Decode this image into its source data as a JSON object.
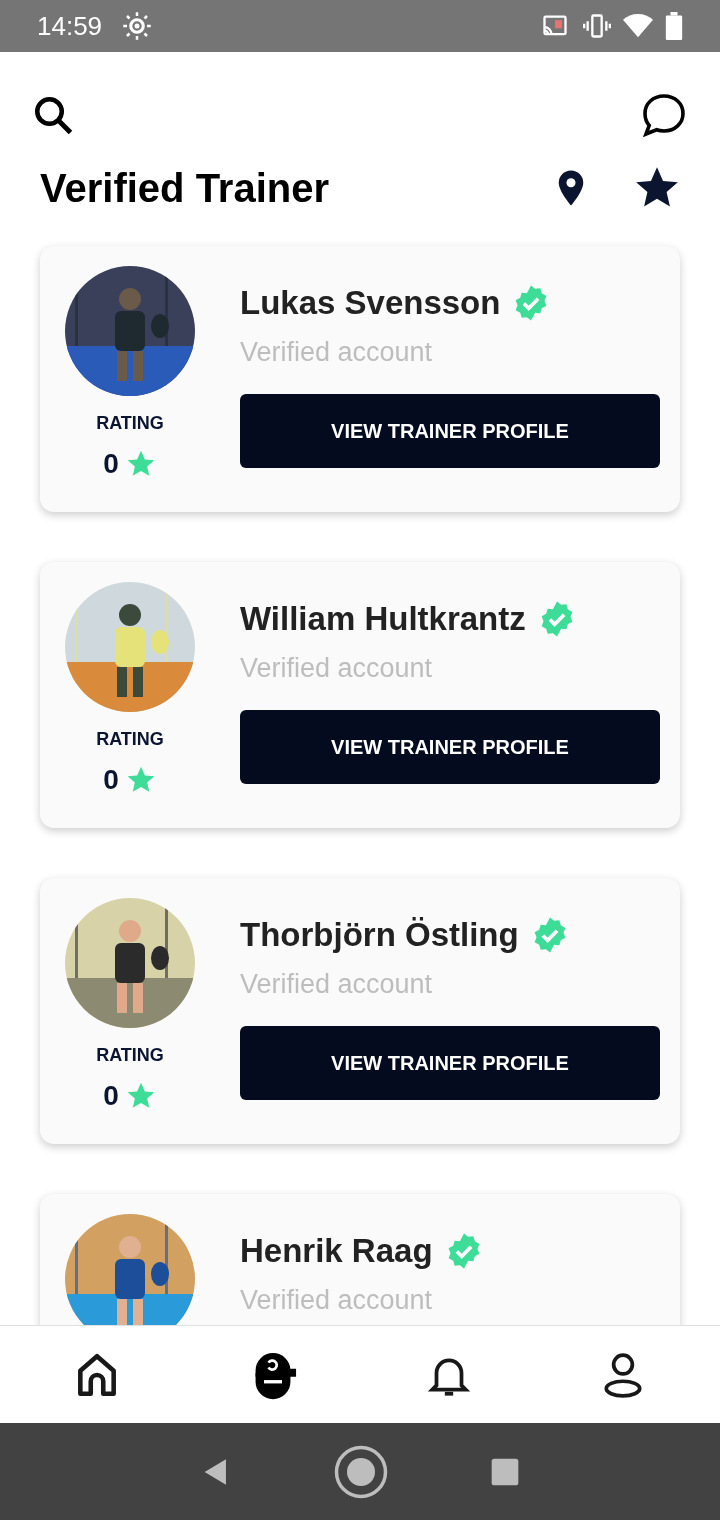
{
  "status_bar": {
    "time": "14:59"
  },
  "header": {
    "title": "Verified Trainer"
  },
  "trainers": [
    {
      "name": "Lukas Svensson",
      "subtitle": "Verified account",
      "rating_label": "RATING",
      "rating": "0",
      "button": "VIEW TRAINER PROFILE"
    },
    {
      "name": "William Hultkrantz",
      "subtitle": "Verified account",
      "rating_label": "RATING",
      "rating": "0",
      "button": "VIEW TRAINER PROFILE"
    },
    {
      "name": "Thorbjörn Östling",
      "subtitle": "Verified account",
      "rating_label": "RATING",
      "rating": "0",
      "button": "VIEW TRAINER PROFILE"
    },
    {
      "name": "Henrik Raag",
      "subtitle": "Verified account"
    }
  ],
  "bottom_nav": [
    {
      "kind": "home",
      "selected": false
    },
    {
      "kind": "trainer",
      "selected": true
    },
    {
      "kind": "bell",
      "selected": false
    },
    {
      "kind": "profile",
      "selected": false
    }
  ]
}
